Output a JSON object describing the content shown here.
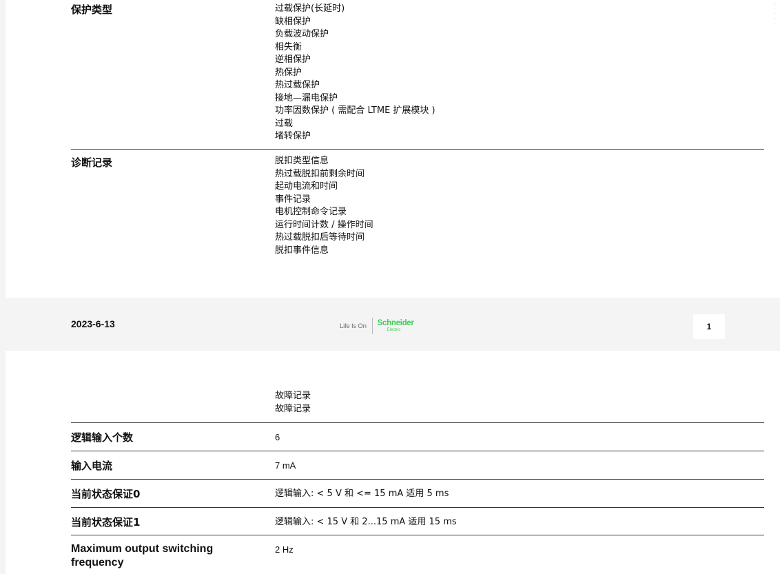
{
  "sections": [
    {
      "label": "保护类型",
      "values": [
        "过载保护(长延时)",
        "缺相保护",
        "负载波动保护",
        "相失衡",
        "逆相保护",
        "热保护",
        "热过载保护",
        "接地—漏电保护",
        "功率因数保护 ( 需配合 LTME 扩展模块 )",
        "过载",
        "堵转保护"
      ]
    },
    {
      "label": "诊断记录",
      "values": [
        "脱扣类型信息",
        "热过载脱扣前剩余时间",
        "起动电流和时间",
        "事件记录",
        "电机控制命令记录",
        "运行时间计数 / 操作时间",
        "热过载脱扣后等待时间",
        "脱扣事件信息"
      ]
    }
  ],
  "footer": {
    "date": "2023-6-13",
    "logo_tagline": "Life Is On",
    "logo_brand": "Schneider",
    "logo_brand_sub": "Electric",
    "page_number": "1"
  },
  "continuation": {
    "values": [
      "故障记录",
      "故障记录"
    ]
  },
  "spec_rows": [
    {
      "label": "逻辑输入个数",
      "value": "6"
    },
    {
      "label": "输入电流",
      "value": "7 mA"
    },
    {
      "label": "当前状态保证0",
      "value": "逻辑输入: < 5 V 和 <= 15 mA 适用 5 ms"
    },
    {
      "label": "当前状态保证1",
      "value": "逻辑输入: < 15 V 和 2...15 mA 适用 15 ms"
    },
    {
      "label": "Maximum output switching frequency",
      "value": "2 Hz"
    }
  ]
}
